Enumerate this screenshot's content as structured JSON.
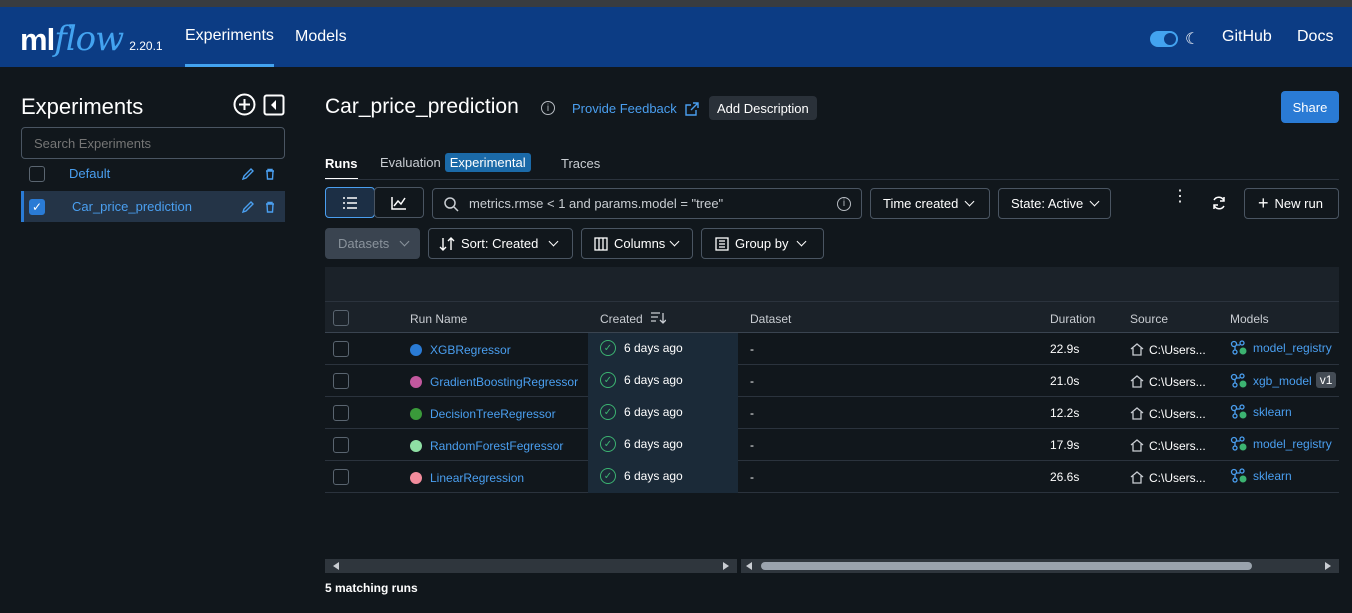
{
  "header": {
    "logo_ml": "ml",
    "logo_flow": "flow",
    "version": "2.20.1",
    "nav": [
      {
        "label": "Experiments",
        "active": true
      },
      {
        "label": "Models",
        "active": false
      }
    ],
    "github": "GitHub",
    "docs": "Docs",
    "dark_mode": true
  },
  "sidebar": {
    "title": "Experiments",
    "search_placeholder": "Search Experiments",
    "experiments": [
      {
        "name": "Default",
        "checked": false
      },
      {
        "name": "Car_price_prediction",
        "checked": true
      }
    ]
  },
  "main": {
    "title": "Car_price_prediction",
    "feedback": "Provide Feedback",
    "add_description": "Add Description",
    "share": "Share",
    "tabs": [
      {
        "label": "Runs",
        "active": true
      },
      {
        "label": "Evaluation",
        "badge": "Experimental"
      },
      {
        "label": "Traces"
      }
    ],
    "search_placeholder": "metrics.rmse < 1 and params.model = \"tree\"",
    "time_created": "Time created",
    "state": "State: Active",
    "new_run": "New run",
    "datasets": "Datasets",
    "sort": "Sort: Created",
    "columns": "Columns",
    "group_by": "Group by",
    "footer": "5 matching runs"
  },
  "table": {
    "headers": {
      "run_name": "Run Name",
      "created": "Created",
      "dataset": "Dataset",
      "duration": "Duration",
      "source": "Source",
      "models": "Models"
    },
    "rows": [
      {
        "name": "XGBRegressor",
        "color": "#2a7bd5",
        "created": "6 days ago",
        "dataset": "-",
        "duration": "22.9s",
        "source": "C:\\Users...",
        "model": "model_registry",
        "version": ""
      },
      {
        "name": "GradientBoostingRegressor",
        "color": "#c2589e",
        "created": "6 days ago",
        "dataset": "-",
        "duration": "21.0s",
        "source": "C:\\Users...",
        "model": "xgb_model",
        "version": "v1"
      },
      {
        "name": "DecisionTreeRegressor",
        "color": "#3a9a3a",
        "created": "6 days ago",
        "dataset": "-",
        "duration": "12.2s",
        "source": "C:\\Users...",
        "model": "sklearn",
        "version": ""
      },
      {
        "name": "RandomForestFegressor",
        "color": "#8fe0a4",
        "created": "6 days ago",
        "dataset": "-",
        "duration": "17.9s",
        "source": "C:\\Users...",
        "model": "model_registry",
        "version": ""
      },
      {
        "name": "LinearRegression",
        "color": "#f28c9c",
        "created": "6 days ago",
        "dataset": "-",
        "duration": "26.6s",
        "source": "C:\\Users...",
        "model": "sklearn",
        "version": ""
      }
    ]
  }
}
